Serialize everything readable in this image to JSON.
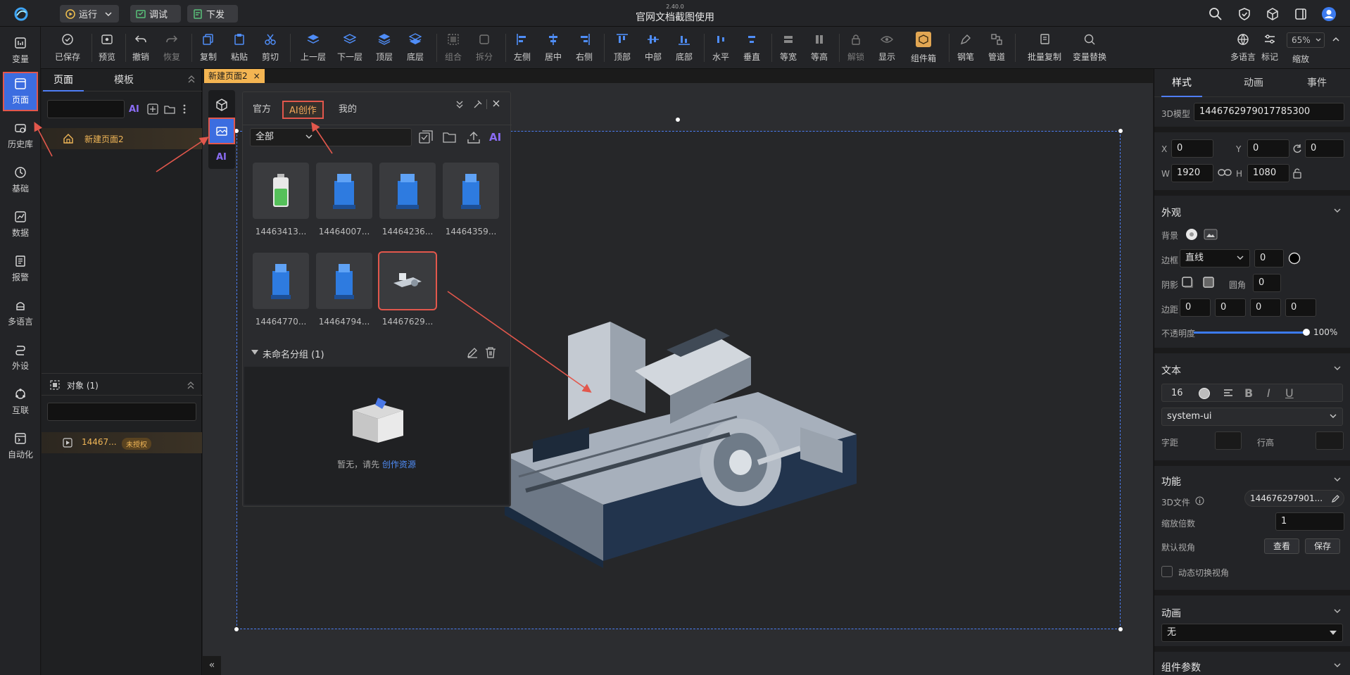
{
  "app": {
    "title": "官网文档截图使用",
    "version": "2.40.0"
  },
  "topbar": {
    "run": "运行",
    "debug": "调试",
    "deploy": "下发"
  },
  "toolbar": {
    "items": [
      "已保存",
      "预览",
      "撤销",
      "恢复",
      "复制",
      "粘贴",
      "剪切",
      "上一层",
      "下一层",
      "顶层",
      "底层",
      "组合",
      "拆分",
      "左侧",
      "居中",
      "右侧",
      "顶部",
      "中部",
      "底部",
      "水平",
      "垂直",
      "等宽",
      "等高",
      "解锁",
      "显示",
      "组件箱",
      "钢笔",
      "管道",
      "批量复制",
      "变量替换"
    ],
    "right": [
      "多语言",
      "标记",
      "缩放"
    ],
    "zoom": "65%",
    "tooltip": "显示"
  },
  "leftnav": [
    "变量",
    "页面",
    "历史库",
    "基础",
    "数据",
    "报警",
    "多语言",
    "外设",
    "互联",
    "自动化"
  ],
  "pages_panel": {
    "tab_pages": "页面",
    "tab_templates": "模板",
    "ai": "AI",
    "page_item": "新建页面2",
    "objects_title": "对象 (1)",
    "object_item": "14467...",
    "object_badge": "未授权"
  },
  "canvas": {
    "doc_tab": "新建页面2",
    "collapse": "«"
  },
  "library": {
    "tabs": [
      "官方",
      "AI创作",
      "我的"
    ],
    "filter": "全部",
    "ai": "AI",
    "items": [
      "14463413...",
      "14464007...",
      "14464236...",
      "14464359...",
      "14464770...",
      "14464794...",
      "14467629..."
    ],
    "group_title": "未命名分组 (1)",
    "empty_text": "暂无，请先",
    "empty_link": "创作资源"
  },
  "props": {
    "tabs": [
      "样式",
      "动画",
      "事件"
    ],
    "model_label": "3D模型",
    "model_id": "1446762979017785300",
    "x_label": "X",
    "x": "0",
    "y_label": "Y",
    "y": "0",
    "rot": "0",
    "w_label": "W",
    "w": "1920",
    "h_label": "H",
    "h": "1080",
    "appearance": "外观",
    "bg_label": "背景",
    "border_label": "边框",
    "border_type": "直线",
    "border_w": "0",
    "shadow_label": "阴影",
    "radius_label": "圆角",
    "radius": "0",
    "padding_label": "边距",
    "pad": [
      "0",
      "0",
      "0",
      "0"
    ],
    "opacity_label": "不透明度",
    "opacity": "100%",
    "opacity_value": 100,
    "text": "文本",
    "font_size": "16",
    "font_family": "system-ui",
    "spacing_label": "字距",
    "line_label": "行高",
    "function": "功能",
    "file_label": "3D文件",
    "file_value": "144676297901...",
    "scale_label": "缩放倍数",
    "scale": "1",
    "view_label": "默认视角",
    "view_btn": "查看",
    "save_btn": "保存",
    "dynamic_label": "动态切换视角",
    "animation": "动画",
    "animation_value": "无",
    "params": "组件参数"
  }
}
